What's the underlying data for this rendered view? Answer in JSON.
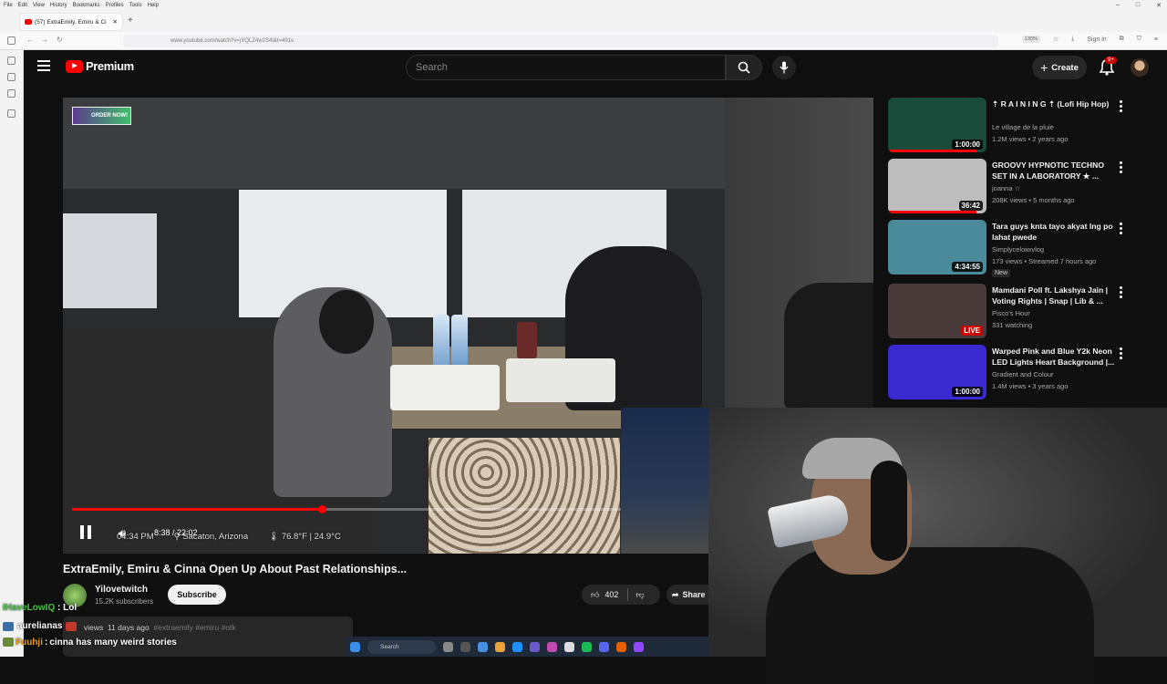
{
  "browser": {
    "menu": [
      "File",
      "Edit",
      "View",
      "History",
      "Bookmarks",
      "Profiles",
      "Tools",
      "Help"
    ],
    "tab_title": "(57) ExtraEmily, Emiru & Ci",
    "url": "www.youtube.com/watch?v=jYQLZ4w2S4I&t=491s",
    "zoom": "130%",
    "sign_in": "Sign in"
  },
  "header": {
    "logo_text": "Premium",
    "search_placeholder": "Search",
    "create_label": "Create",
    "notif_count": "9+"
  },
  "video": {
    "time": "8:38 / 22:02",
    "progress_fraction": 0.392,
    "overlay_clock": "04:34 PM",
    "overlay_location": "Sacaton, Arizona",
    "overlay_temp": "76.8°F | 24.9°C",
    "overlay_badge": "ORDER NOW!",
    "title": "ExtraEmily, Emiru & Cinna Open Up About Past Relationships...",
    "channel": "Yilovetwitch",
    "subscribers": "15.2K subscribers",
    "subscribe_label": "Subscribe",
    "likes": "402",
    "share_label": "Share",
    "desc_views": "views",
    "desc_age": "11 days ago",
    "desc_tags": "#extraemily #emiru #otk"
  },
  "chat": [
    {
      "user": "IHaveLowIQ",
      "sep": ":",
      "text": "Lol"
    },
    {
      "user": "aurelianas",
      "sep": "",
      "text": ""
    },
    {
      "user": "Fuuhji",
      "sep": ":",
      "text": "cinna has many weird stories"
    }
  ],
  "taskbar": {
    "search_label": "Search"
  },
  "recommendations": [
    {
      "title": "⇡ R A I N I N G ⇡ (Lofi Hip Hop)",
      "channel": "Le village de la pluie",
      "meta": "1.2M views • 2 years ago",
      "duration": "1:00:00",
      "watched": 0.9,
      "thumb_color": "#1a4a3a"
    },
    {
      "title": "GROOVY HYPNOTIC TECHNO SET IN A LABORATORY ★ ...",
      "channel": "joanna ☆",
      "meta": "208K views • 5 months ago",
      "duration": "36:42",
      "watched": 0.9,
      "thumb_color": "#bdbdbd"
    },
    {
      "title": "Tara guys knta tayo akyat lng po lahat pwede",
      "channel": "Simplyceloiwvlog",
      "meta": "173 views • Streamed 7 hours ago",
      "duration": "4:34:55",
      "new_label": "New",
      "watched": 0,
      "thumb_color": "#4a8a9a"
    },
    {
      "title": "Mamdani Poll ft. Lakshya Jain | Voting Rights | Snap | Lib & ...",
      "channel": "Pisco's Hour",
      "meta": "331 watching",
      "duration": "LIVE",
      "watched": 0,
      "thumb_color": "#4a3a3a"
    },
    {
      "title": "Warped Pink and Blue Y2k Neon LED Lights Heart Background |...",
      "channel": "Gradient and Colour",
      "meta": "1.4M views • 3 years ago",
      "duration": "1:00:00",
      "watched": 0,
      "thumb_color": "#3a2ad0"
    }
  ]
}
